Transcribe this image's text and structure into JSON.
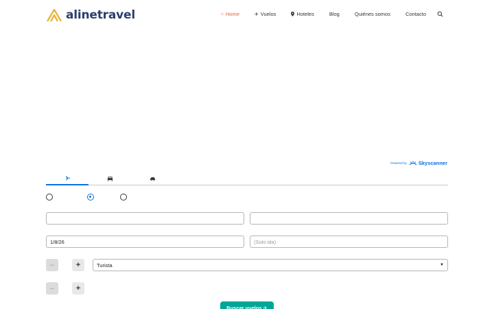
{
  "brand": {
    "name": "alinetravel",
    "logo_color": "#e8b53c",
    "text_color": "#2a3f6b"
  },
  "nav": {
    "items": [
      {
        "label": "Home",
        "icon": "home-icon",
        "active": true
      },
      {
        "label": "Vuelos",
        "icon": "plane-icon",
        "active": false
      },
      {
        "label": "Hoteles",
        "icon": "map-pin-icon",
        "active": false
      },
      {
        "label": "Blog",
        "icon": "",
        "active": false
      },
      {
        "label": "Quiénes somos",
        "icon": "",
        "active": false
      },
      {
        "label": "Contacto",
        "icon": "",
        "active": false
      }
    ],
    "active_color": "#e8603c"
  },
  "widget": {
    "powered_by": "Powered by",
    "provider": "Skyscanner",
    "accent": "#0770e3",
    "tabs": [
      {
        "icon": "plane-icon",
        "active": true
      },
      {
        "icon": "bed-icon",
        "active": false
      },
      {
        "icon": "car-icon",
        "active": false
      }
    ],
    "trip_types": [
      {
        "checked": false
      },
      {
        "checked": true
      },
      {
        "checked": false
      }
    ],
    "origin": {
      "value": ""
    },
    "destination": {
      "value": ""
    },
    "depart": {
      "value": "1/8/26"
    },
    "return": {
      "placeholder": "(Solo ida)"
    },
    "cabin": {
      "value": "Turista"
    },
    "search_label": "Buscar vuelos ✈",
    "search_color": "#00a698"
  }
}
